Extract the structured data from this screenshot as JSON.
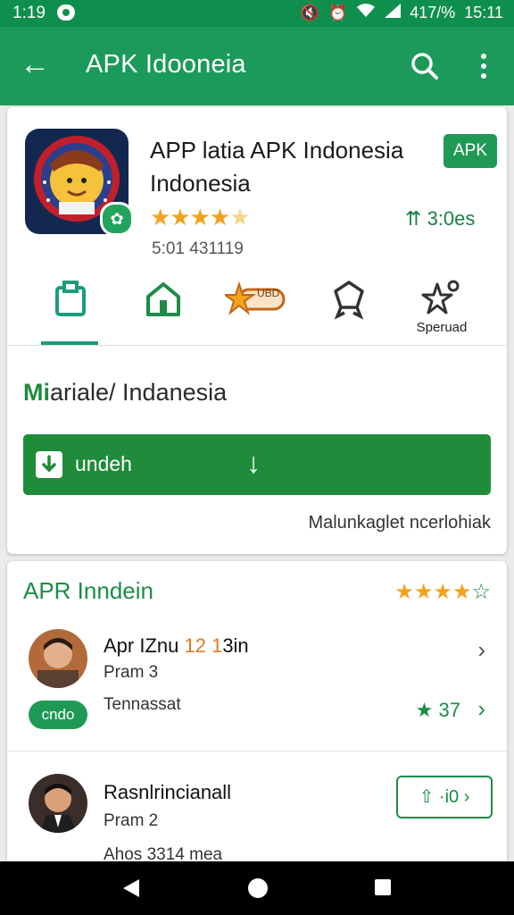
{
  "status_bar": {
    "time_left": "1:19",
    "battery": "417/%",
    "time_right": "15:11",
    "icons": [
      "notification-icon",
      "mute-icon",
      "alarm-icon",
      "wifi-icon",
      "signal-icon"
    ]
  },
  "app_bar": {
    "title": "APK Idooneia",
    "icons": [
      "back-arrow-icon",
      "search-icon",
      "more-vert-icon"
    ]
  },
  "app": {
    "name_line1": "APP latia APK Indonesia",
    "name_line2": "Indonesia",
    "badge": "APK",
    "rating_stars": 4.5,
    "size": "3:0es",
    "version": "5:01 431119"
  },
  "tabs": [
    {
      "icon": "clipboard-icon",
      "label": ""
    },
    {
      "icon": "home-icon",
      "label": ""
    },
    {
      "icon": "star-badge-icon",
      "label": "",
      "badge_text": "UBD"
    },
    {
      "icon": "award-icon",
      "label": ""
    },
    {
      "icon": "star-pin-icon",
      "label": "Speruad"
    }
  ],
  "section": {
    "prefix": "Mi",
    "title": "ariale/ Indanesia"
  },
  "download": {
    "label": "undeh"
  },
  "help_text": "Malunkaglet ncerlohiak",
  "reviews": {
    "title": "APR Inndein",
    "items": [
      {
        "name_prefix": "Apr IZnu ",
        "name_number": "12 1",
        "name_suffix": "3in",
        "sub": "Pram 3",
        "text": "Tennassat",
        "pill": "cndo",
        "rating": "37"
      },
      {
        "name": "Rasnlrincianall",
        "sub": "Pram 2",
        "text": "Ahos 3314 mea",
        "button": "⇧ ·i0 ›"
      }
    ]
  },
  "colors": {
    "primary": "#1c9a5a",
    "status_bar": "#0f8f4d",
    "button_green": "#1e8c3a",
    "accent_star": "#f2a31b"
  }
}
